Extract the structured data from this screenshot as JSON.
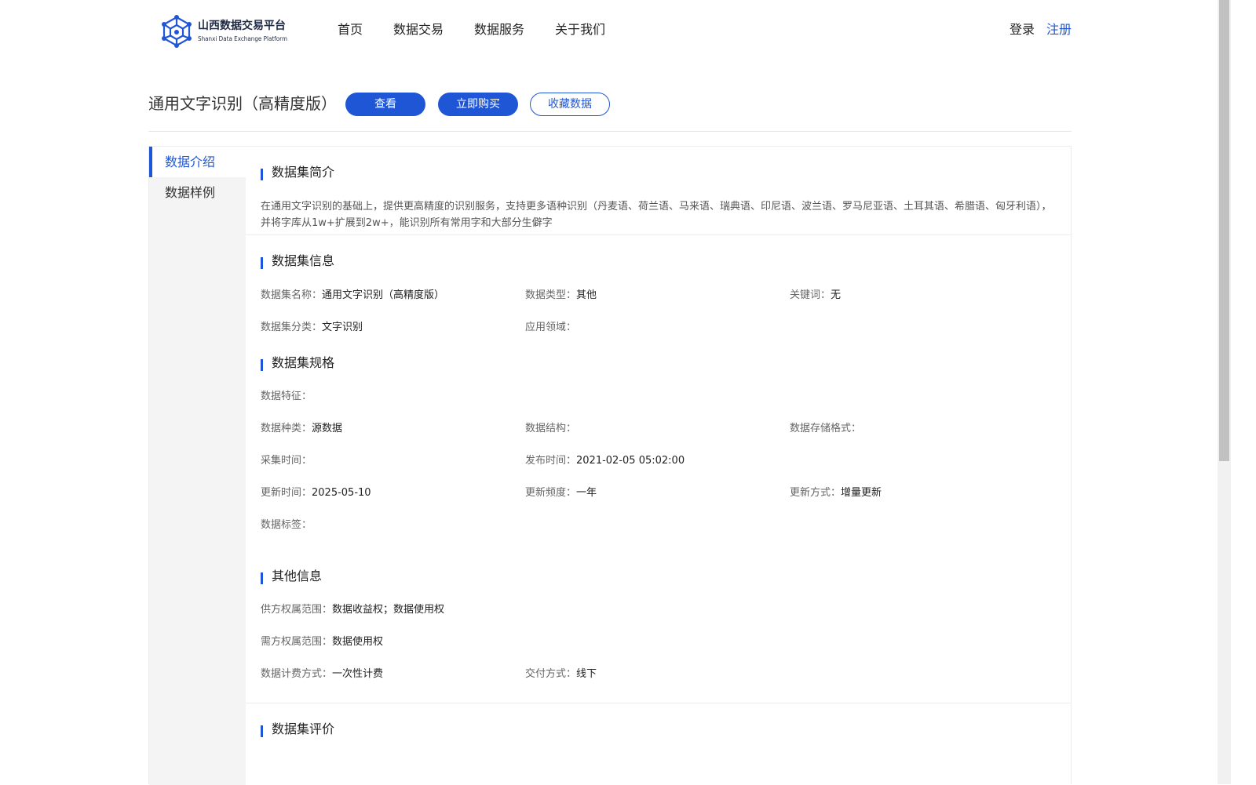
{
  "header": {
    "logo_cn": "山西数据交易平台",
    "logo_en": "Shanxi Data Exchange Platform",
    "nav": [
      "首页",
      "数据交易",
      "数据服务",
      "关于我们"
    ],
    "login": "登录",
    "register": "注册"
  },
  "product": {
    "title": "通用文字识别（高精度版）",
    "view_btn": "查看",
    "buy_btn": "立即购买",
    "fav_btn": "收藏数据"
  },
  "sidebar": {
    "items": [
      {
        "label": "数据介绍",
        "active": true
      },
      {
        "label": "数据样例",
        "active": false
      }
    ]
  },
  "intro": {
    "title": "数据集简介",
    "text": "在通用文字识别的基础上，提供更高精度的识别服务，支持更多语种识别（丹麦语、荷兰语、马来语、瑞典语、印尼语、波兰语、罗马尼亚语、土耳其语、希腊语、匈牙利语），并将字库从1w+扩展到2w+，能识别所有常用字和大部分生僻字"
  },
  "info": {
    "title": "数据集信息",
    "name_k": "数据集名称：",
    "name_v": "通用文字识别（高精度版）",
    "type_k": "数据类型：",
    "type_v": "其他",
    "keywords_k": "关键词：",
    "keywords_v": "无",
    "category_k": "数据集分类：",
    "category_v": "文字识别",
    "domain_k": "应用领域：",
    "domain_v": ""
  },
  "spec": {
    "title": "数据集规格",
    "feature_k": "数据特征：",
    "feature_v": "",
    "kind_k": "数据种类：",
    "kind_v": "源数据",
    "structure_k": "数据结构：",
    "structure_v": "",
    "storage_k": "数据存储格式：",
    "storage_v": "",
    "collect_k": "采集时间：",
    "collect_v": "",
    "publish_k": "发布时间：",
    "publish_v": "2021-02-05 05:02:00",
    "update_k": "更新时间：",
    "update_v": "2025-05-10",
    "freq_k": "更新频度：",
    "freq_v": "一年",
    "method_k": "更新方式：",
    "method_v": "增量更新",
    "tags_k": "数据标签：",
    "tags_v": ""
  },
  "other": {
    "title": "其他信息",
    "supply_k": "供方权属范围：",
    "supply_v": "数据收益权；数据使用权",
    "demand_k": "需方权属范围：",
    "demand_v": "数据使用权",
    "billing_k": "数据计费方式：",
    "billing_v": "一次性计费",
    "delivery_k": "交付方式：",
    "delivery_v": "线下"
  },
  "review": {
    "title": "数据集评价"
  },
  "colors": {
    "accent": "#1f56d6",
    "sidebar_bg": "#f4f4f4"
  }
}
